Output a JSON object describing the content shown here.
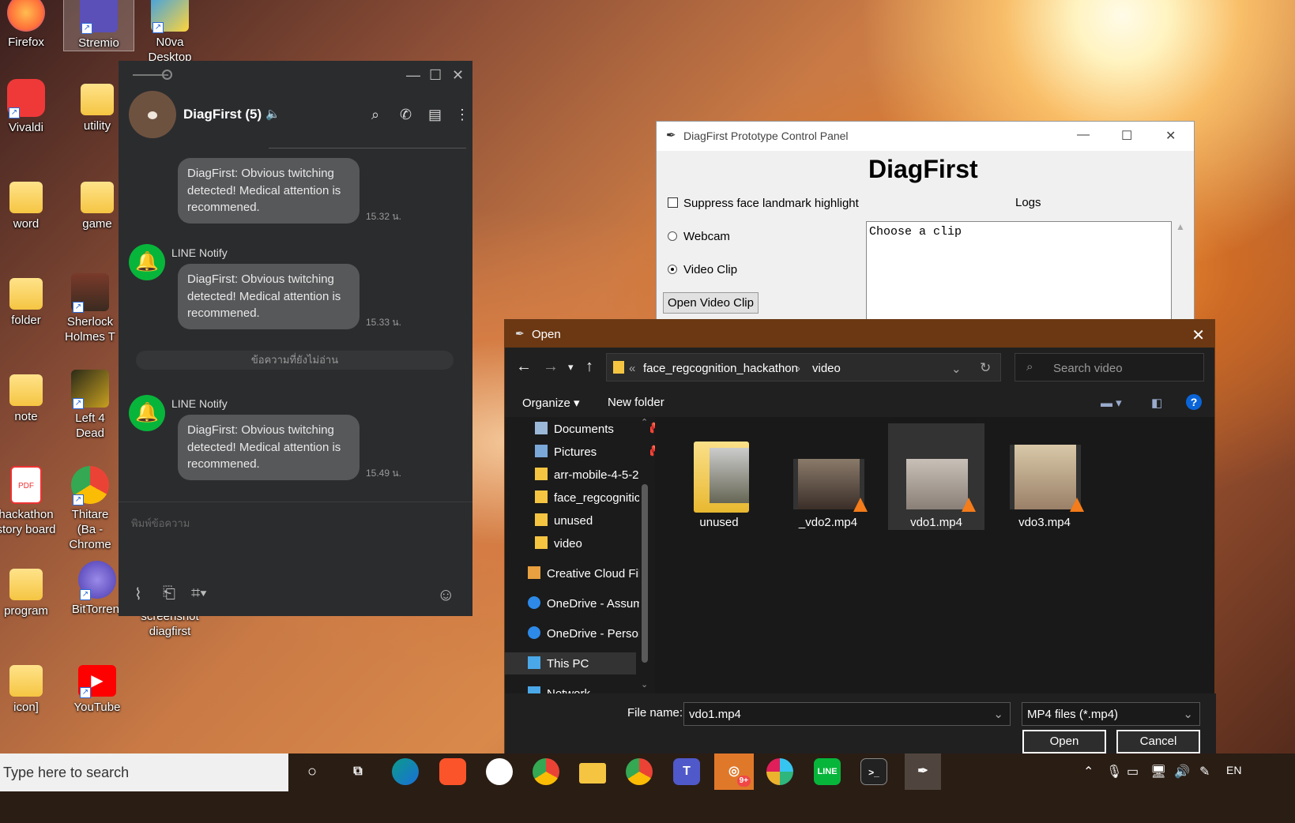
{
  "desktop": {
    "icons": [
      {
        "label": "Firefox",
        "glyph": "firefox-icon",
        "color": "#ff7139"
      },
      {
        "label": "Stremio",
        "glyph": "stremio-icon",
        "color": "#5b4fb8"
      },
      {
        "label": "N0va Desktop",
        "glyph": "n0va-icon",
        "color": "#3aa0e8"
      },
      {
        "label": "Vivaldi",
        "glyph": "vivaldi-icon",
        "color": "#ef3939"
      },
      {
        "label": "utility",
        "glyph": "folder-icon",
        "color": "#f5c542"
      },
      {
        "label": "word",
        "glyph": "folder-icon",
        "color": "#f5c542"
      },
      {
        "label": "game",
        "glyph": "folder-icon",
        "color": "#f5c542"
      },
      {
        "label": "folder",
        "glyph": "folder-icon",
        "color": "#f5c542"
      },
      {
        "label": "Sherlock Holmes T",
        "glyph": "sherlock-icon",
        "color": "#8a5a3a"
      },
      {
        "label": "note",
        "glyph": "folder-icon",
        "color": "#f5c542"
      },
      {
        "label": "Left 4 Dead",
        "glyph": "l4d-icon",
        "color": "#4a4a2a"
      },
      {
        "label": "hackathon story board",
        "glyph": "pdf-icon",
        "color": "#e33"
      },
      {
        "label": "Thitare (Ba - Chrome",
        "glyph": "chrome-icon",
        "color": "#4285f4"
      },
      {
        "label": "program",
        "glyph": "folder-icon",
        "color": "#f5c542"
      },
      {
        "label": "BitTorrent",
        "glyph": "bittorrent-icon",
        "color": "#6a5acd"
      },
      {
        "label": "screenshot diagfirst",
        "glyph": "folder-icon",
        "color": "#f5c542"
      },
      {
        "label": "icon]",
        "glyph": "folder-icon",
        "color": "#f5c542"
      },
      {
        "label": "YouTube",
        "glyph": "youtube-icon",
        "color": "#ff0000"
      }
    ]
  },
  "line": {
    "chat_title": "DiagFirst (5)",
    "messages": [
      {
        "text": "DiagFirst: Obvious twitching detected! Medical attention is recommened.",
        "time": "15.32 น."
      },
      {
        "sender": "LINE Notify",
        "text": "DiagFirst: Obvious twitching detected! Medical attention is recommened.",
        "time": "15.33 น."
      },
      {
        "sender": "LINE Notify",
        "text": "DiagFirst: Obvious twitching detected! Medical attention is recommened.",
        "time": "15.49 น."
      }
    ],
    "unread_divider": "ข้อความที่ยังไม่อ่าน",
    "input_placeholder": "พิมพ์ข้อความ",
    "accent": "#07b53b"
  },
  "control_panel": {
    "window_title": "DiagFirst Prototype Control Panel",
    "heading": "DiagFirst",
    "suppress_label": "Suppress face landmark highlight",
    "suppress_checked": false,
    "webcam_label": "Webcam",
    "video_clip_label": "Video Clip",
    "selected_source": "Video Clip",
    "open_button": "Open Video Clip",
    "logs_label": "Logs",
    "logs_text": "Choose a clip"
  },
  "open_dialog": {
    "title": "Open",
    "breadcrumb": [
      "face_regcognition_hackathon",
      "video"
    ],
    "search_placeholder": "Search video",
    "organize": "Organize",
    "new_folder": "New folder",
    "tree": [
      {
        "label": "Documents",
        "pinned": true
      },
      {
        "label": "Pictures",
        "pinned": true
      },
      {
        "label": "arr-mobile-4-5-2"
      },
      {
        "label": "face_regcognitic"
      },
      {
        "label": "unused"
      },
      {
        "label": "video"
      },
      {
        "label": "Creative Cloud Fil"
      },
      {
        "label": "OneDrive - Assum"
      },
      {
        "label": "OneDrive - Persor"
      },
      {
        "label": "This PC",
        "selected": true
      },
      {
        "label": "Network"
      }
    ],
    "files": [
      {
        "name": "unused",
        "kind": "folder"
      },
      {
        "name": "_vdo2.mp4",
        "kind": "video"
      },
      {
        "name": "vdo1.mp4",
        "kind": "video",
        "selected": true
      },
      {
        "name": "vdo3.mp4",
        "kind": "video"
      }
    ],
    "file_name_label": "File name:",
    "file_name_value": "vdo1.mp4",
    "file_type": "MP4 files (*.mp4)",
    "open_button": "Open",
    "cancel_button": "Cancel"
  },
  "taskbar": {
    "search_placeholder": "Type here to search",
    "apps": [
      "cortana-icon",
      "task-view-icon",
      "edge-icon",
      "brave-icon",
      "n0va-icon",
      "chrome-icon",
      "file-explorer-icon",
      "chrome-profile-icon",
      "teams-icon",
      "discord-icon",
      "slack-icon",
      "line-icon",
      "terminal-icon",
      "python-feather-icon"
    ],
    "discord_badge": "9+",
    "tray_lang": "EN"
  }
}
